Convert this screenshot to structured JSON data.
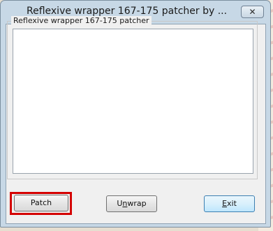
{
  "window": {
    "title": "Reflexive wrapper 167-175 patcher by ...",
    "close_glyph": "✕"
  },
  "group": {
    "label": "Reflexive wrapper 167-175 patcher",
    "log_text": ""
  },
  "buttons": {
    "patch": "Patch",
    "unwrap_prefix": "U",
    "unwrap_mnemonic": "n",
    "unwrap_rest": "wrap",
    "exit_mnemonic": "E",
    "exit_rest": "xit"
  },
  "colors": {
    "highlight": "#d40000",
    "titlebar": "#c7d8e6",
    "default_button_border": "#3c7fb1"
  }
}
